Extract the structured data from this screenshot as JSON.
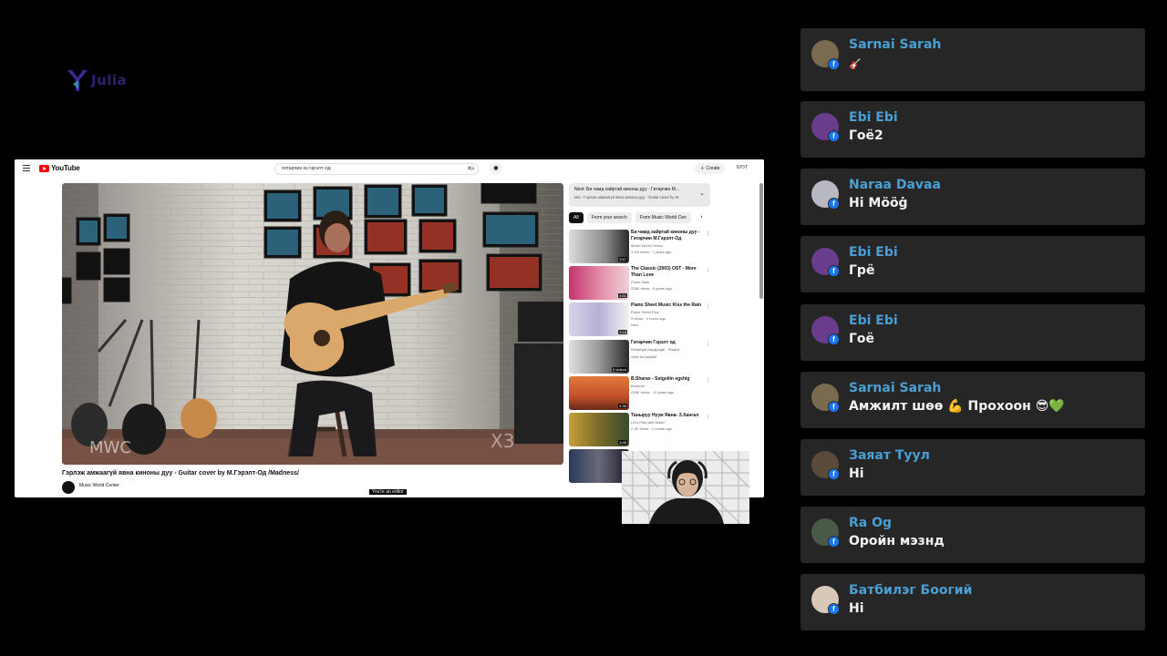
{
  "brand": {
    "logo_text": "Julia"
  },
  "youtube": {
    "logo_word": "YouTube",
    "search_value": "гитарчин м.гэрэлт-од",
    "create_label": "Create",
    "user_label": "БЛУГ",
    "video_title": "Гэрлэж амжаагүй явна киноны дуу - Guitar cover by М.Гэрэлт-Од /Madness/",
    "channel_name": "Music World Center",
    "watermark_left": "MWC",
    "watermark_right": "X3",
    "editor_notice": "You're an editor",
    "next_title": "Next: Би чамд хайртай киноны дуу - Гитарчин М...",
    "next_sub": "Mix - Гэрлэж амжаагүй явна киноны дуу - Guitar cover by М.",
    "chips": [
      "All",
      "From your search",
      "From Music World Cen"
    ],
    "related": [
      {
        "title": "Би чамд хайртай киноны дуу - Гитарчин М.Гэрэлт-Од",
        "meta1": "Music World Center",
        "meta2": "1.1M views · 7 years ago",
        "duration": "3:57"
      },
      {
        "title": "The Classic (2003) OST - More Than Love",
        "meta1": "Purint Sails",
        "meta2": "228K views · 8 years ago",
        "duration": "4:51"
      },
      {
        "title": "Piano Sheet Music Kiss the Rain",
        "meta1": "Piano Sheet Plus",
        "meta2": "3 views · 4 hours ago",
        "meta3": "New",
        "duration": "3:18"
      },
      {
        "title": "Гитарчин Гэрэлт од",
        "meta1": "Renjargal Bayajargal · Playlist",
        "meta2": "View full playlist",
        "duration": "6 videos"
      },
      {
        "title": "B.Sharav - Setgeliin egshig",
        "meta1": "Boorkhii",
        "meta2": "238K views · 12 years ago",
        "duration": "4:36"
      },
      {
        "title": "Таныруу Нүүж Явна- З.Хангал",
        "meta1": "Let's Play with Mash!",
        "meta2": "2.2K views · 1 month ago",
        "duration": "3:46"
      }
    ]
  },
  "chat": [
    {
      "name": "Sarnai Sarah",
      "message": "🎸",
      "avatar_color": "#7a6a50"
    },
    {
      "name": "Ebi Ebi",
      "message": "Гоё2",
      "avatar_color": "#6a3c8c"
    },
    {
      "name": "Naraa Davaa",
      "message": "Hi Mööġ",
      "avatar_color": "#b9b9c4"
    },
    {
      "name": "Ebi Ebi",
      "message": "Грё",
      "avatar_color": "#6a3c8c"
    },
    {
      "name": "Ebi Ebi",
      "message": "Гоё",
      "avatar_color": "#6a3c8c"
    },
    {
      "name": "Sarnai Sarah",
      "message": "Амжилт шөө 💪 Прохоон 😎💚",
      "avatar_color": "#7a6a50"
    },
    {
      "name": "Заяат Туул",
      "message": "Hi",
      "avatar_color": "#5a4a3a"
    },
    {
      "name": "Ra Og",
      "message": "Оройн мэзнд",
      "avatar_color": "#4a5a48"
    },
    {
      "name": "Батбилэг Боогий",
      "message": "Hi",
      "avatar_color": "#d8c8b8"
    }
  ],
  "colors": {
    "chat_name": "#4a9fd4",
    "chat_bg": "#262626",
    "fb_blue": "#1877f2",
    "yt_red": "#ff0000"
  }
}
